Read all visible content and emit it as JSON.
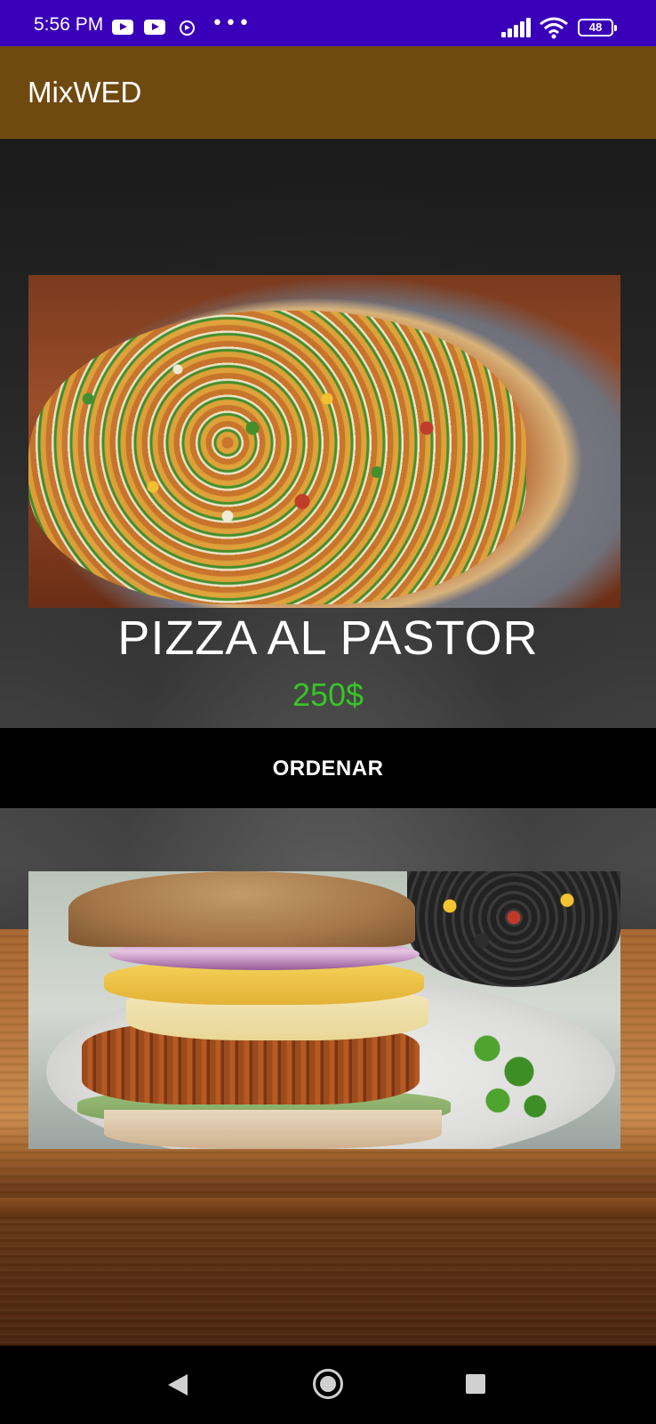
{
  "status_bar": {
    "time": "5:56 PM",
    "icons": [
      "youtube-icon",
      "youtube-icon",
      "play-circle-icon",
      "more-dots-icon",
      "signal-icon",
      "wifi-icon",
      "battery-icon"
    ],
    "more": "•••",
    "battery_level": "48"
  },
  "app_bar": {
    "title": "MixWED"
  },
  "menu": {
    "items": [
      {
        "name": "PIZZA AL PASTOR",
        "price": "250$",
        "order_label": "ORDENAR"
      }
    ]
  },
  "colors": {
    "status_bar": "#3a00b9",
    "app_bar": "#6f4a10",
    "price": "#38c427",
    "order_button": "#000000",
    "nav_bar": "#000000"
  },
  "nav_bar": {
    "icons": [
      "back-icon",
      "home-icon",
      "recents-icon"
    ]
  }
}
